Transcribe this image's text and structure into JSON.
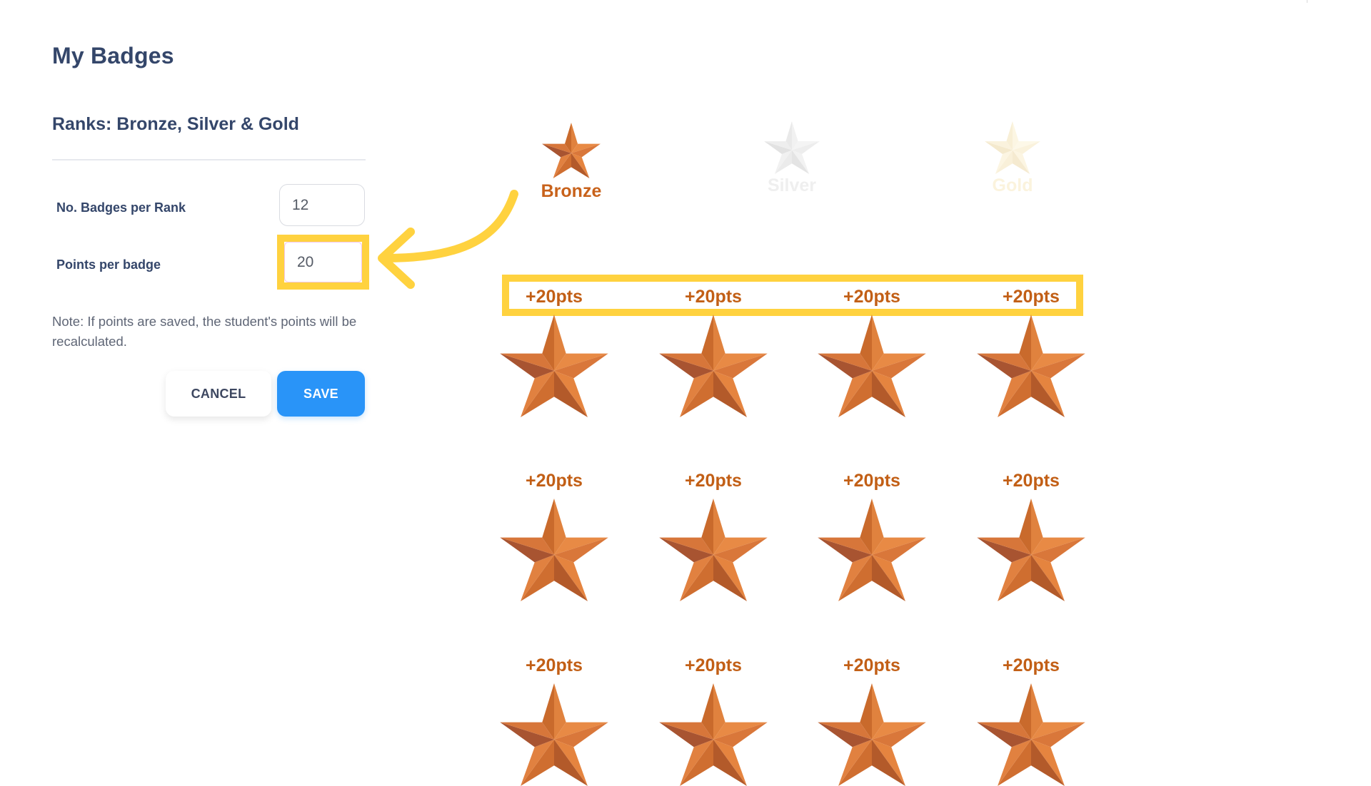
{
  "page": {
    "title": "My Badges",
    "section_title": "Ranks: Bronze, Silver & Gold"
  },
  "form": {
    "badges_per_rank": {
      "label": "No. Badges per Rank",
      "value": "12"
    },
    "points_per_badge": {
      "label": "Points per badge",
      "value": "20"
    },
    "note": "Note: If points are saved, the student's points will be recalculated.",
    "cancel_label": "CANCEL",
    "save_label": "SAVE"
  },
  "ranks": [
    {
      "name": "Bronze",
      "selected": true,
      "color": "#c8621b"
    },
    {
      "name": "Silver",
      "selected": false,
      "color": "#e8e8e8"
    },
    {
      "name": "Gold",
      "selected": false,
      "color": "#fbf3dd"
    }
  ],
  "badges": {
    "rank": "Bronze",
    "count_visible": 12,
    "columns": 4,
    "items": [
      {
        "points_label": "+20pts",
        "icon": "bronze-star-icon"
      },
      {
        "points_label": "+20pts",
        "icon": "bronze-star-icon"
      },
      {
        "points_label": "+20pts",
        "icon": "bronze-star-icon"
      },
      {
        "points_label": "+20pts",
        "icon": "bronze-star-icon"
      },
      {
        "points_label": "+20pts",
        "icon": "bronze-star-icon"
      },
      {
        "points_label": "+20pts",
        "icon": "bronze-star-icon"
      },
      {
        "points_label": "+20pts",
        "icon": "bronze-star-icon"
      },
      {
        "points_label": "+20pts",
        "icon": "bronze-star-icon"
      },
      {
        "points_label": "+20pts",
        "icon": "bronze-star-icon"
      },
      {
        "points_label": "+20pts",
        "icon": "bronze-star-icon"
      },
      {
        "points_label": "+20pts",
        "icon": "bronze-star-icon"
      },
      {
        "points_label": "+20pts",
        "icon": "bronze-star-icon"
      }
    ]
  },
  "annotation": {
    "highlight_color": "#ffd23f",
    "arrow": "curved-arrow-left"
  },
  "colors": {
    "heading": "#34466a",
    "accent_blue": "#2994f8",
    "bronze_text": "#c25f16"
  }
}
